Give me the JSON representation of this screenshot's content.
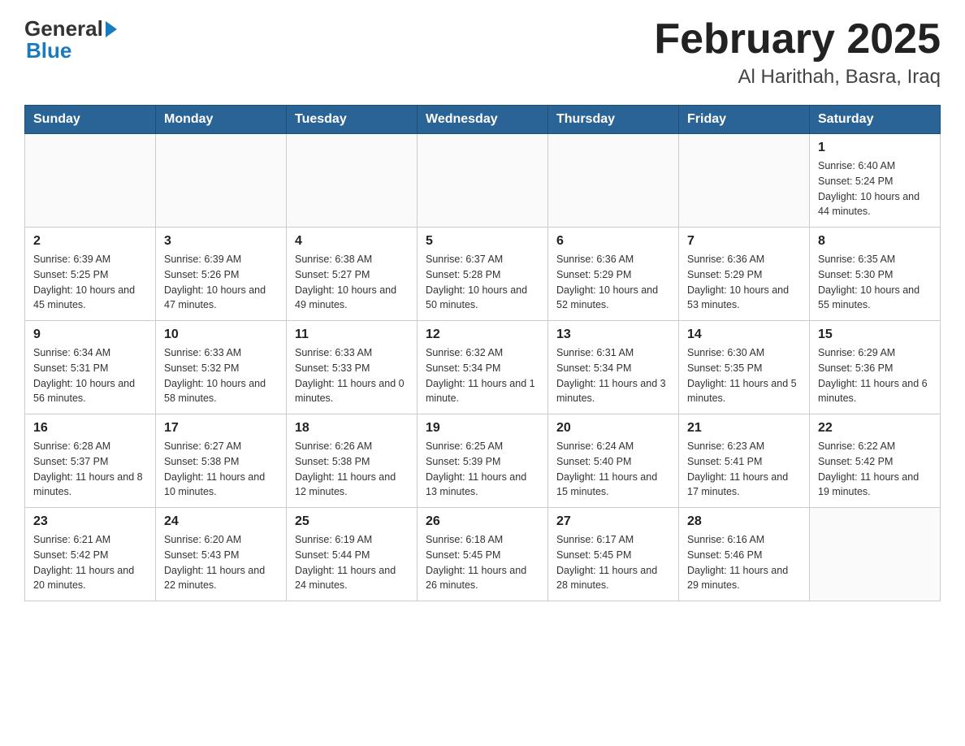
{
  "header": {
    "logo_general": "General",
    "logo_blue": "Blue",
    "month_title": "February 2025",
    "location": "Al Harithah, Basra, Iraq"
  },
  "days_of_week": [
    "Sunday",
    "Monday",
    "Tuesday",
    "Wednesday",
    "Thursday",
    "Friday",
    "Saturday"
  ],
  "weeks": [
    [
      {
        "day": "",
        "info": ""
      },
      {
        "day": "",
        "info": ""
      },
      {
        "day": "",
        "info": ""
      },
      {
        "day": "",
        "info": ""
      },
      {
        "day": "",
        "info": ""
      },
      {
        "day": "",
        "info": ""
      },
      {
        "day": "1",
        "info": "Sunrise: 6:40 AM\nSunset: 5:24 PM\nDaylight: 10 hours and 44 minutes."
      }
    ],
    [
      {
        "day": "2",
        "info": "Sunrise: 6:39 AM\nSunset: 5:25 PM\nDaylight: 10 hours and 45 minutes."
      },
      {
        "day": "3",
        "info": "Sunrise: 6:39 AM\nSunset: 5:26 PM\nDaylight: 10 hours and 47 minutes."
      },
      {
        "day": "4",
        "info": "Sunrise: 6:38 AM\nSunset: 5:27 PM\nDaylight: 10 hours and 49 minutes."
      },
      {
        "day": "5",
        "info": "Sunrise: 6:37 AM\nSunset: 5:28 PM\nDaylight: 10 hours and 50 minutes."
      },
      {
        "day": "6",
        "info": "Sunrise: 6:36 AM\nSunset: 5:29 PM\nDaylight: 10 hours and 52 minutes."
      },
      {
        "day": "7",
        "info": "Sunrise: 6:36 AM\nSunset: 5:29 PM\nDaylight: 10 hours and 53 minutes."
      },
      {
        "day": "8",
        "info": "Sunrise: 6:35 AM\nSunset: 5:30 PM\nDaylight: 10 hours and 55 minutes."
      }
    ],
    [
      {
        "day": "9",
        "info": "Sunrise: 6:34 AM\nSunset: 5:31 PM\nDaylight: 10 hours and 56 minutes."
      },
      {
        "day": "10",
        "info": "Sunrise: 6:33 AM\nSunset: 5:32 PM\nDaylight: 10 hours and 58 minutes."
      },
      {
        "day": "11",
        "info": "Sunrise: 6:33 AM\nSunset: 5:33 PM\nDaylight: 11 hours and 0 minutes."
      },
      {
        "day": "12",
        "info": "Sunrise: 6:32 AM\nSunset: 5:34 PM\nDaylight: 11 hours and 1 minute."
      },
      {
        "day": "13",
        "info": "Sunrise: 6:31 AM\nSunset: 5:34 PM\nDaylight: 11 hours and 3 minutes."
      },
      {
        "day": "14",
        "info": "Sunrise: 6:30 AM\nSunset: 5:35 PM\nDaylight: 11 hours and 5 minutes."
      },
      {
        "day": "15",
        "info": "Sunrise: 6:29 AM\nSunset: 5:36 PM\nDaylight: 11 hours and 6 minutes."
      }
    ],
    [
      {
        "day": "16",
        "info": "Sunrise: 6:28 AM\nSunset: 5:37 PM\nDaylight: 11 hours and 8 minutes."
      },
      {
        "day": "17",
        "info": "Sunrise: 6:27 AM\nSunset: 5:38 PM\nDaylight: 11 hours and 10 minutes."
      },
      {
        "day": "18",
        "info": "Sunrise: 6:26 AM\nSunset: 5:38 PM\nDaylight: 11 hours and 12 minutes."
      },
      {
        "day": "19",
        "info": "Sunrise: 6:25 AM\nSunset: 5:39 PM\nDaylight: 11 hours and 13 minutes."
      },
      {
        "day": "20",
        "info": "Sunrise: 6:24 AM\nSunset: 5:40 PM\nDaylight: 11 hours and 15 minutes."
      },
      {
        "day": "21",
        "info": "Sunrise: 6:23 AM\nSunset: 5:41 PM\nDaylight: 11 hours and 17 minutes."
      },
      {
        "day": "22",
        "info": "Sunrise: 6:22 AM\nSunset: 5:42 PM\nDaylight: 11 hours and 19 minutes."
      }
    ],
    [
      {
        "day": "23",
        "info": "Sunrise: 6:21 AM\nSunset: 5:42 PM\nDaylight: 11 hours and 20 minutes."
      },
      {
        "day": "24",
        "info": "Sunrise: 6:20 AM\nSunset: 5:43 PM\nDaylight: 11 hours and 22 minutes."
      },
      {
        "day": "25",
        "info": "Sunrise: 6:19 AM\nSunset: 5:44 PM\nDaylight: 11 hours and 24 minutes."
      },
      {
        "day": "26",
        "info": "Sunrise: 6:18 AM\nSunset: 5:45 PM\nDaylight: 11 hours and 26 minutes."
      },
      {
        "day": "27",
        "info": "Sunrise: 6:17 AM\nSunset: 5:45 PM\nDaylight: 11 hours and 28 minutes."
      },
      {
        "day": "28",
        "info": "Sunrise: 6:16 AM\nSunset: 5:46 PM\nDaylight: 11 hours and 29 minutes."
      },
      {
        "day": "",
        "info": ""
      }
    ]
  ]
}
